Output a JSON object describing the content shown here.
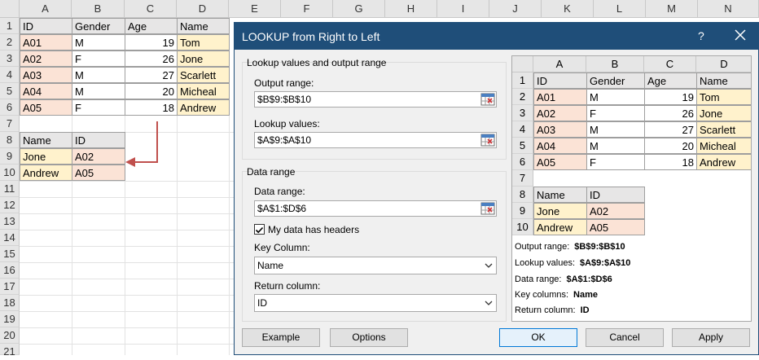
{
  "sheet": {
    "columns": [
      "A",
      "B",
      "C",
      "D",
      "E",
      "F",
      "G",
      "H",
      "I",
      "J",
      "K",
      "L",
      "M",
      "N"
    ],
    "rows": [
      "1",
      "2",
      "3",
      "4",
      "5",
      "6",
      "7",
      "8",
      "9",
      "10",
      "11",
      "12",
      "13",
      "14",
      "15",
      "16",
      "17",
      "18",
      "19",
      "20",
      "21"
    ],
    "table1": {
      "headers": [
        "ID",
        "Gender",
        "Age",
        "Name"
      ],
      "rows": [
        [
          "A01",
          "M",
          "19",
          "Tom"
        ],
        [
          "A02",
          "F",
          "26",
          "Jone"
        ],
        [
          "A03",
          "M",
          "27",
          "Scarlett"
        ],
        [
          "A04",
          "M",
          "20",
          "Micheal"
        ],
        [
          "A05",
          "F",
          "18",
          "Andrew"
        ]
      ]
    },
    "table2": {
      "headers": [
        "Name",
        "ID"
      ],
      "rows": [
        [
          "Jone",
          "A02"
        ],
        [
          "Andrew",
          "A05"
        ]
      ]
    }
  },
  "dialog": {
    "title": "LOOKUP from Right to Left",
    "help": "?",
    "group1_label": "Lookup values and output range",
    "output_range_label": "Output range:",
    "output_range_value": "$B$9:$B$10",
    "lookup_values_label": "Lookup values:",
    "lookup_values_value": "$A$9:$A$10",
    "group2_label": "Data range",
    "data_range_label": "Data range:",
    "data_range_value": "$A$1:$D$6",
    "headers_checkbox_label": "My data has headers",
    "headers_checked": true,
    "key_column_label": "Key Column:",
    "key_column_value": "Name",
    "return_column_label": "Return column:",
    "return_column_value": "ID",
    "buttons": {
      "example": "Example",
      "options": "Options",
      "ok": "OK",
      "cancel": "Cancel",
      "apply": "Apply"
    },
    "preview": {
      "columns": [
        "A",
        "B",
        "C",
        "D"
      ],
      "rows": [
        "1",
        "2",
        "3",
        "4",
        "5",
        "6",
        "7",
        "8",
        "9",
        "10"
      ],
      "summary": [
        {
          "label": "Output range:",
          "value": "$B$9:$B$10"
        },
        {
          "label": "Lookup values:",
          "value": "$A$9:$A$10"
        },
        {
          "label": "Data range:",
          "value": "$A$1:$D$6"
        },
        {
          "label": "Key columns:",
          "value": "Name"
        },
        {
          "label": "Return column:",
          "value": "ID"
        }
      ]
    }
  },
  "colors": {
    "title_bar": "#1f4e79",
    "id_fill": "#fbe3d6",
    "name_fill": "#fff2cc",
    "arrow": "#c0504d"
  }
}
